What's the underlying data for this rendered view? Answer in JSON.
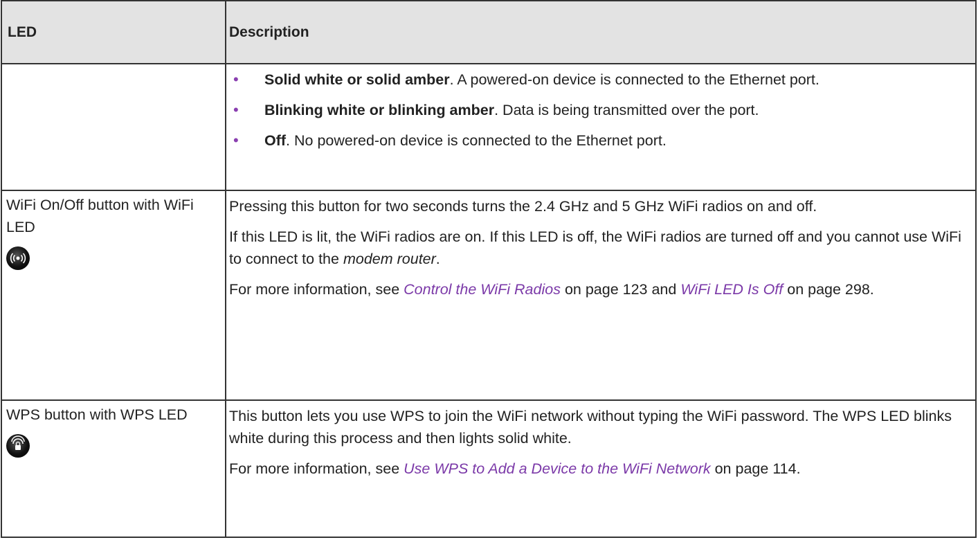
{
  "table": {
    "headers": [
      "LED",
      "Description"
    ],
    "row1": {
      "bullets": [
        {
          "bold": "Solid white or solid amber",
          "rest": ". A powered-on device is connected to the Ethernet port."
        },
        {
          "bold": "Blinking white or blinking amber",
          "rest": ". Data is being transmitted over the port."
        },
        {
          "bold": "Off",
          "rest": ". No powered-on device is connected to the Ethernet port."
        }
      ]
    },
    "row2": {
      "led_label": "WiFi On/Off button with WiFi LED",
      "icon": "wifi-signal-icon",
      "p1": "Pressing this button for two seconds turns the 2.4 GHz and 5 GHz WiFi radios on and off.",
      "p2_a": "If this LED is lit, the WiFi radios are on. If this LED is off, the WiFi radios are turned off and you cannot use WiFi to connect to the ",
      "p2_italic": "modem router",
      "p2_b": ".",
      "p3_a": "For more information, see ",
      "p3_link1": "Control the WiFi Radios",
      "p3_b": " on page 123 and ",
      "p3_link2": "WiFi LED Is Off",
      "p3_c": " on page 298."
    },
    "row3": {
      "led_label": "WPS button with WPS LED",
      "icon": "wps-lock-icon",
      "p1": "This button lets you use WPS to join the WiFi network without typing the WiFi password. The WPS LED blinks white during this process and then lights solid white.",
      "p2_a": "For more information, see ",
      "p2_link": "Use WPS to Add a Device to the WiFi Network",
      "p2_b": " on page 114."
    }
  },
  "colors": {
    "link": "#7b39a8",
    "bullet": "#8a3fb0",
    "header_bg": "#e3e3e3"
  }
}
